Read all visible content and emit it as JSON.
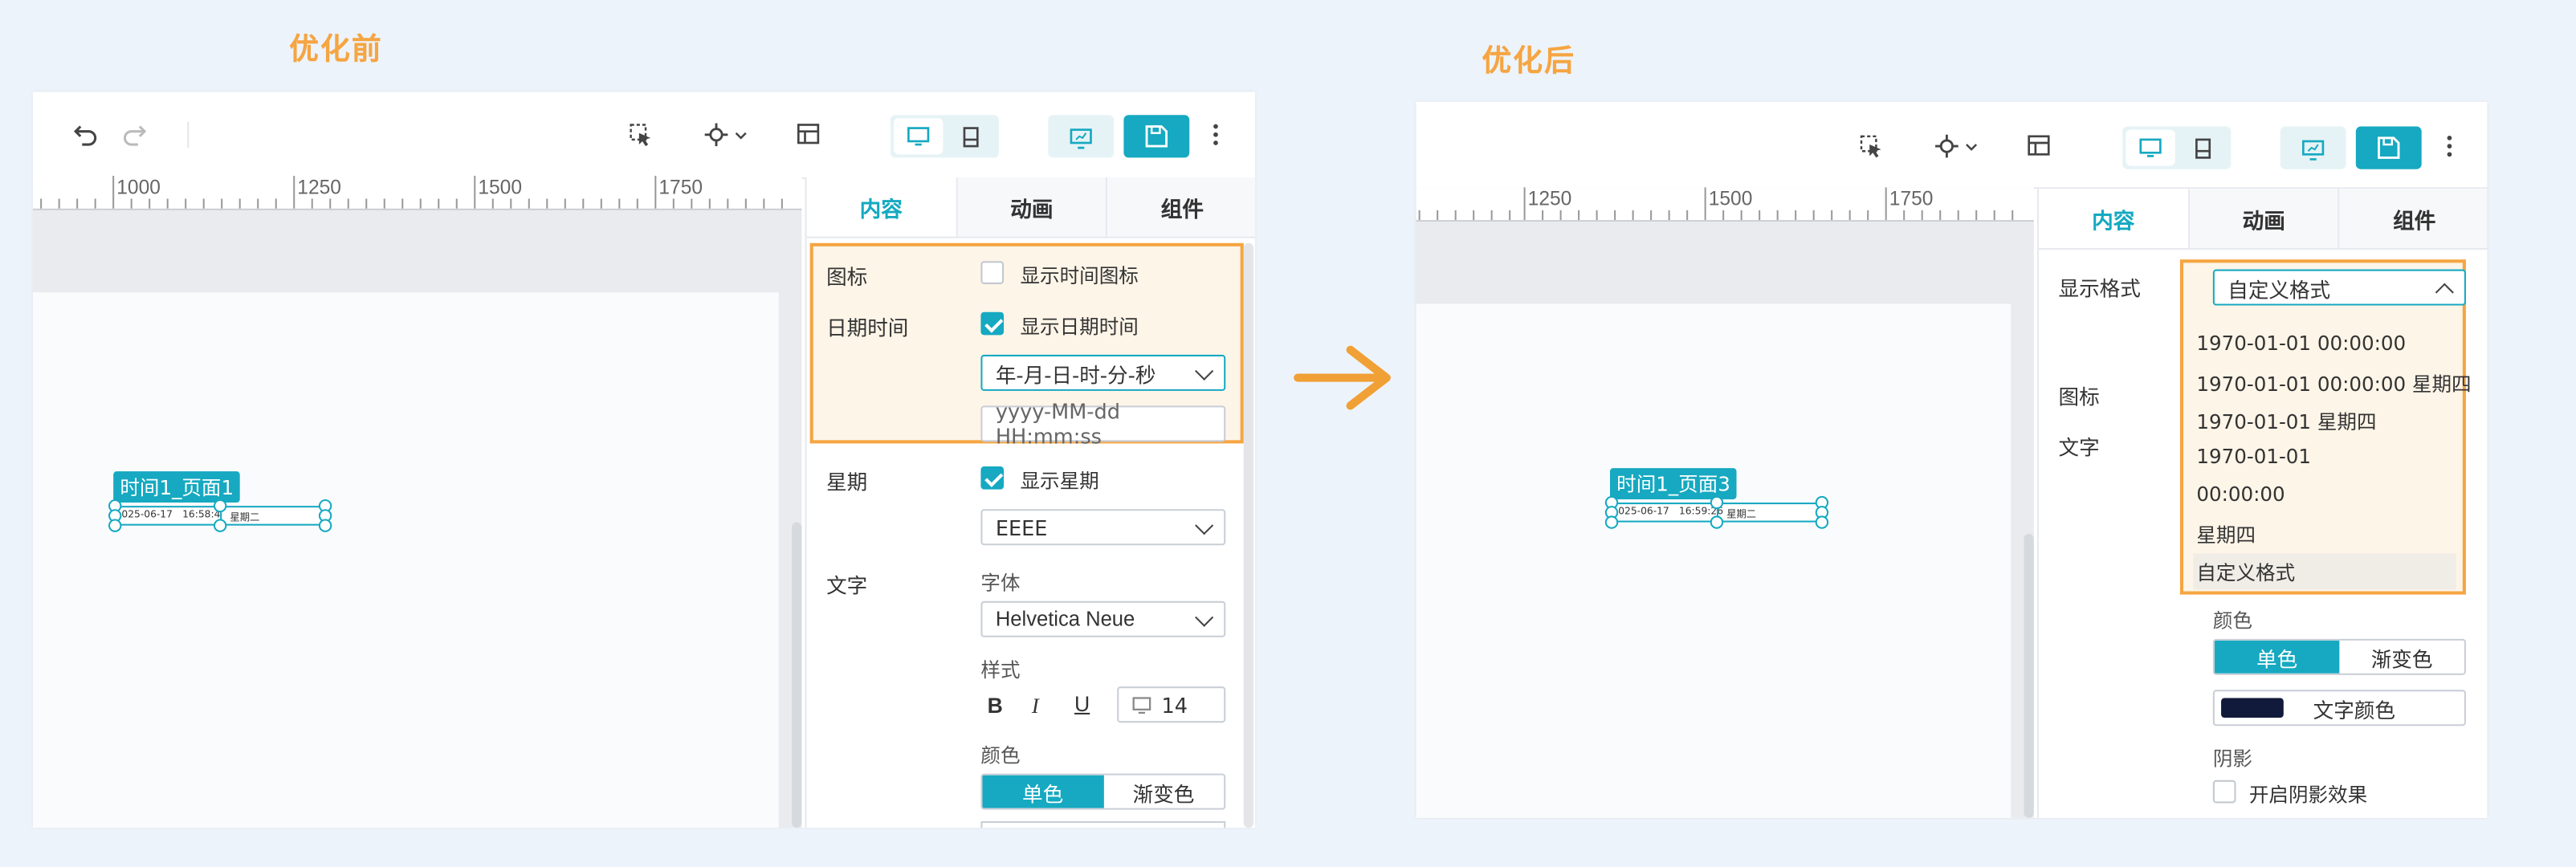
{
  "captions": {
    "before": "优化前",
    "after": "优化后"
  },
  "colors": {
    "accent": "#16a9c1",
    "highlight_border": "#f5a542",
    "caption": "#f5a542",
    "arrow": "#f0a035",
    "text_color_swatch": "#111a3a"
  },
  "icons": {
    "undo": "undo-icon",
    "redo": "redo-icon",
    "cursor": "select-cursor-icon",
    "crosshair": "crosshair-icon",
    "panel": "layout-panel-icon",
    "desktop": "desktop-icon",
    "mobile": "mobile-icon",
    "preview": "preview-icon",
    "save": "save-icon",
    "more": "more-vertical-icon",
    "transition": "right-arrow-icon"
  },
  "before": {
    "ruler": [
      "1000",
      "1250",
      "1500",
      "1750"
    ],
    "tabs": [
      "内容",
      "动画",
      "组件"
    ],
    "component": {
      "tag": "时间1_页面1",
      "date": "025-06-17",
      "time": "16:58:4",
      "week": "星期二"
    },
    "icon_row": {
      "label": "图标",
      "checkbox": "显示时间图标",
      "checked": false
    },
    "datetime_row": {
      "label": "日期时间",
      "checkbox": "显示日期时间",
      "checked": true,
      "format": "年-月-日-时-分-秒",
      "custom_placeholder": "yyyy-MM-dd HH:mm:ss"
    },
    "week_row": {
      "label": "星期",
      "checkbox": "显示星期",
      "checked": true,
      "format": "EEEE"
    },
    "text_row": {
      "label": "文字",
      "font_label": "字体",
      "font": "Helvetica Neue",
      "style_label": "样式",
      "bold": "B",
      "italic": "I",
      "underline": "U",
      "size": "14",
      "color_label": "颜色",
      "solid": "单色",
      "gradient": "渐变色"
    }
  },
  "after": {
    "ruler": [
      "1250",
      "1500",
      "1750"
    ],
    "tabs": [
      "内容",
      "动画",
      "组件"
    ],
    "component": {
      "tag": "时间1_页面3",
      "date": "025-06-17",
      "time": "16:59:26",
      "week": "星期二"
    },
    "format_label": "显示格式",
    "format_selected": "自定义格式",
    "format_options": [
      "1970-01-01 00:00:00",
      "1970-01-01 00:00:00 星期四",
      "1970-01-01 星期四",
      "1970-01-01",
      "00:00:00",
      "星期四",
      "自定义格式"
    ],
    "icon_label": "图标",
    "text_label": "文字",
    "color_label": "颜色",
    "solid": "单色",
    "gradient": "渐变色",
    "text_color_btn": "文字颜色",
    "shadow_label": "阴影",
    "shadow_checkbox": "开启阴影效果"
  }
}
